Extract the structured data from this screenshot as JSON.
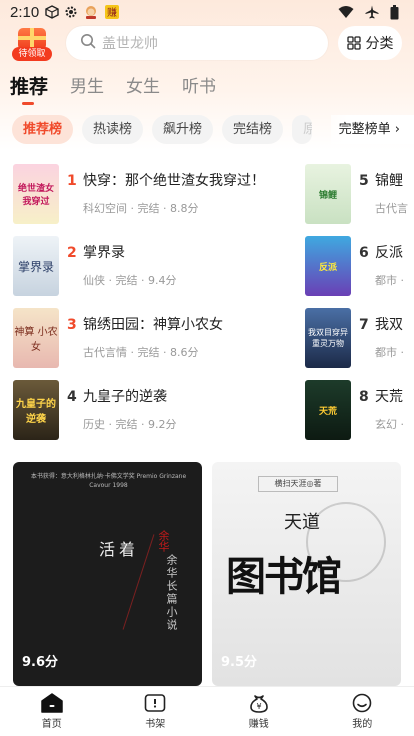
{
  "status_bar": {
    "time": "2:10",
    "icons": [
      "app-3d-icon",
      "settings-icon",
      "avatar-icon",
      "app-badge-icon",
      "wifi-icon",
      "airplane-icon",
      "battery-icon"
    ]
  },
  "header": {
    "gift_label": "待领取",
    "search_placeholder": "盖世龙帅",
    "category_label": "分类"
  },
  "tabs": [
    {
      "label": "推荐",
      "active": true
    },
    {
      "label": "男生",
      "active": false
    },
    {
      "label": "女生",
      "active": false
    },
    {
      "label": "听书",
      "active": false
    }
  ],
  "rank_chips": [
    {
      "label": "推荐榜",
      "active": true
    },
    {
      "label": "热读榜",
      "active": false
    },
    {
      "label": "飙升榜",
      "active": false
    },
    {
      "label": "完结榜",
      "active": false
    },
    {
      "label": "原",
      "active": false
    }
  ],
  "full_rank_label": "完整榜单 ›",
  "ranking": [
    {
      "num": "1",
      "title": "快穿：那个绝世渣女我穿过！",
      "meta": "科幻空间 · 完结 · 8.8分"
    },
    {
      "num": "2",
      "title": "掌界录",
      "meta": "仙侠 · 完结 · 9.4分"
    },
    {
      "num": "3",
      "title": "锦绣田园：神算小农女",
      "meta": "古代言情 · 完结 · 8.6分"
    },
    {
      "num": "4",
      "title": "九皇子的逆袭",
      "meta": "历史 · 完结 · 9.2分"
    },
    {
      "num": "5",
      "title": "锦鲤",
      "meta": "古代言"
    },
    {
      "num": "6",
      "title": "反派",
      "meta": "都市 ·"
    },
    {
      "num": "7",
      "title": "我双",
      "meta": "都市 ·"
    },
    {
      "num": "8",
      "title": "天荒",
      "meta": "玄幻 ·"
    }
  ],
  "cover_text": {
    "c1": "绝世渣女 我穿过",
    "c2": "掌界录",
    "c3": "神算 小农女",
    "c4": "九皇子的 逆袭",
    "c5": "锦鲤",
    "c6": "反派",
    "c7": "我双目穿异 重灵万物",
    "c8": "天荒"
  },
  "cards": [
    {
      "score": "9.6分",
      "top_text": "本书获得：意大利格林扎纳·卡佛文学奖 Premio Grinzane Cavour 1998",
      "title": "活着",
      "red_text": "余华",
      "sub_text": "余华长篇小说"
    },
    {
      "score": "9.5分",
      "author": "横扫天涯◎著",
      "small_title": "天道",
      "title": "图书馆"
    }
  ],
  "bottom_nav": [
    {
      "label": "首页",
      "icon": "home-icon",
      "active": true
    },
    {
      "label": "书架",
      "icon": "bookshelf-icon",
      "active": false
    },
    {
      "label": "赚钱",
      "icon": "money-bag-icon",
      "active": false
    },
    {
      "label": "我的",
      "icon": "profile-icon",
      "active": false
    }
  ],
  "colors": {
    "accent": "#f04a2b",
    "chip_active_bg": "#fde3d8"
  }
}
